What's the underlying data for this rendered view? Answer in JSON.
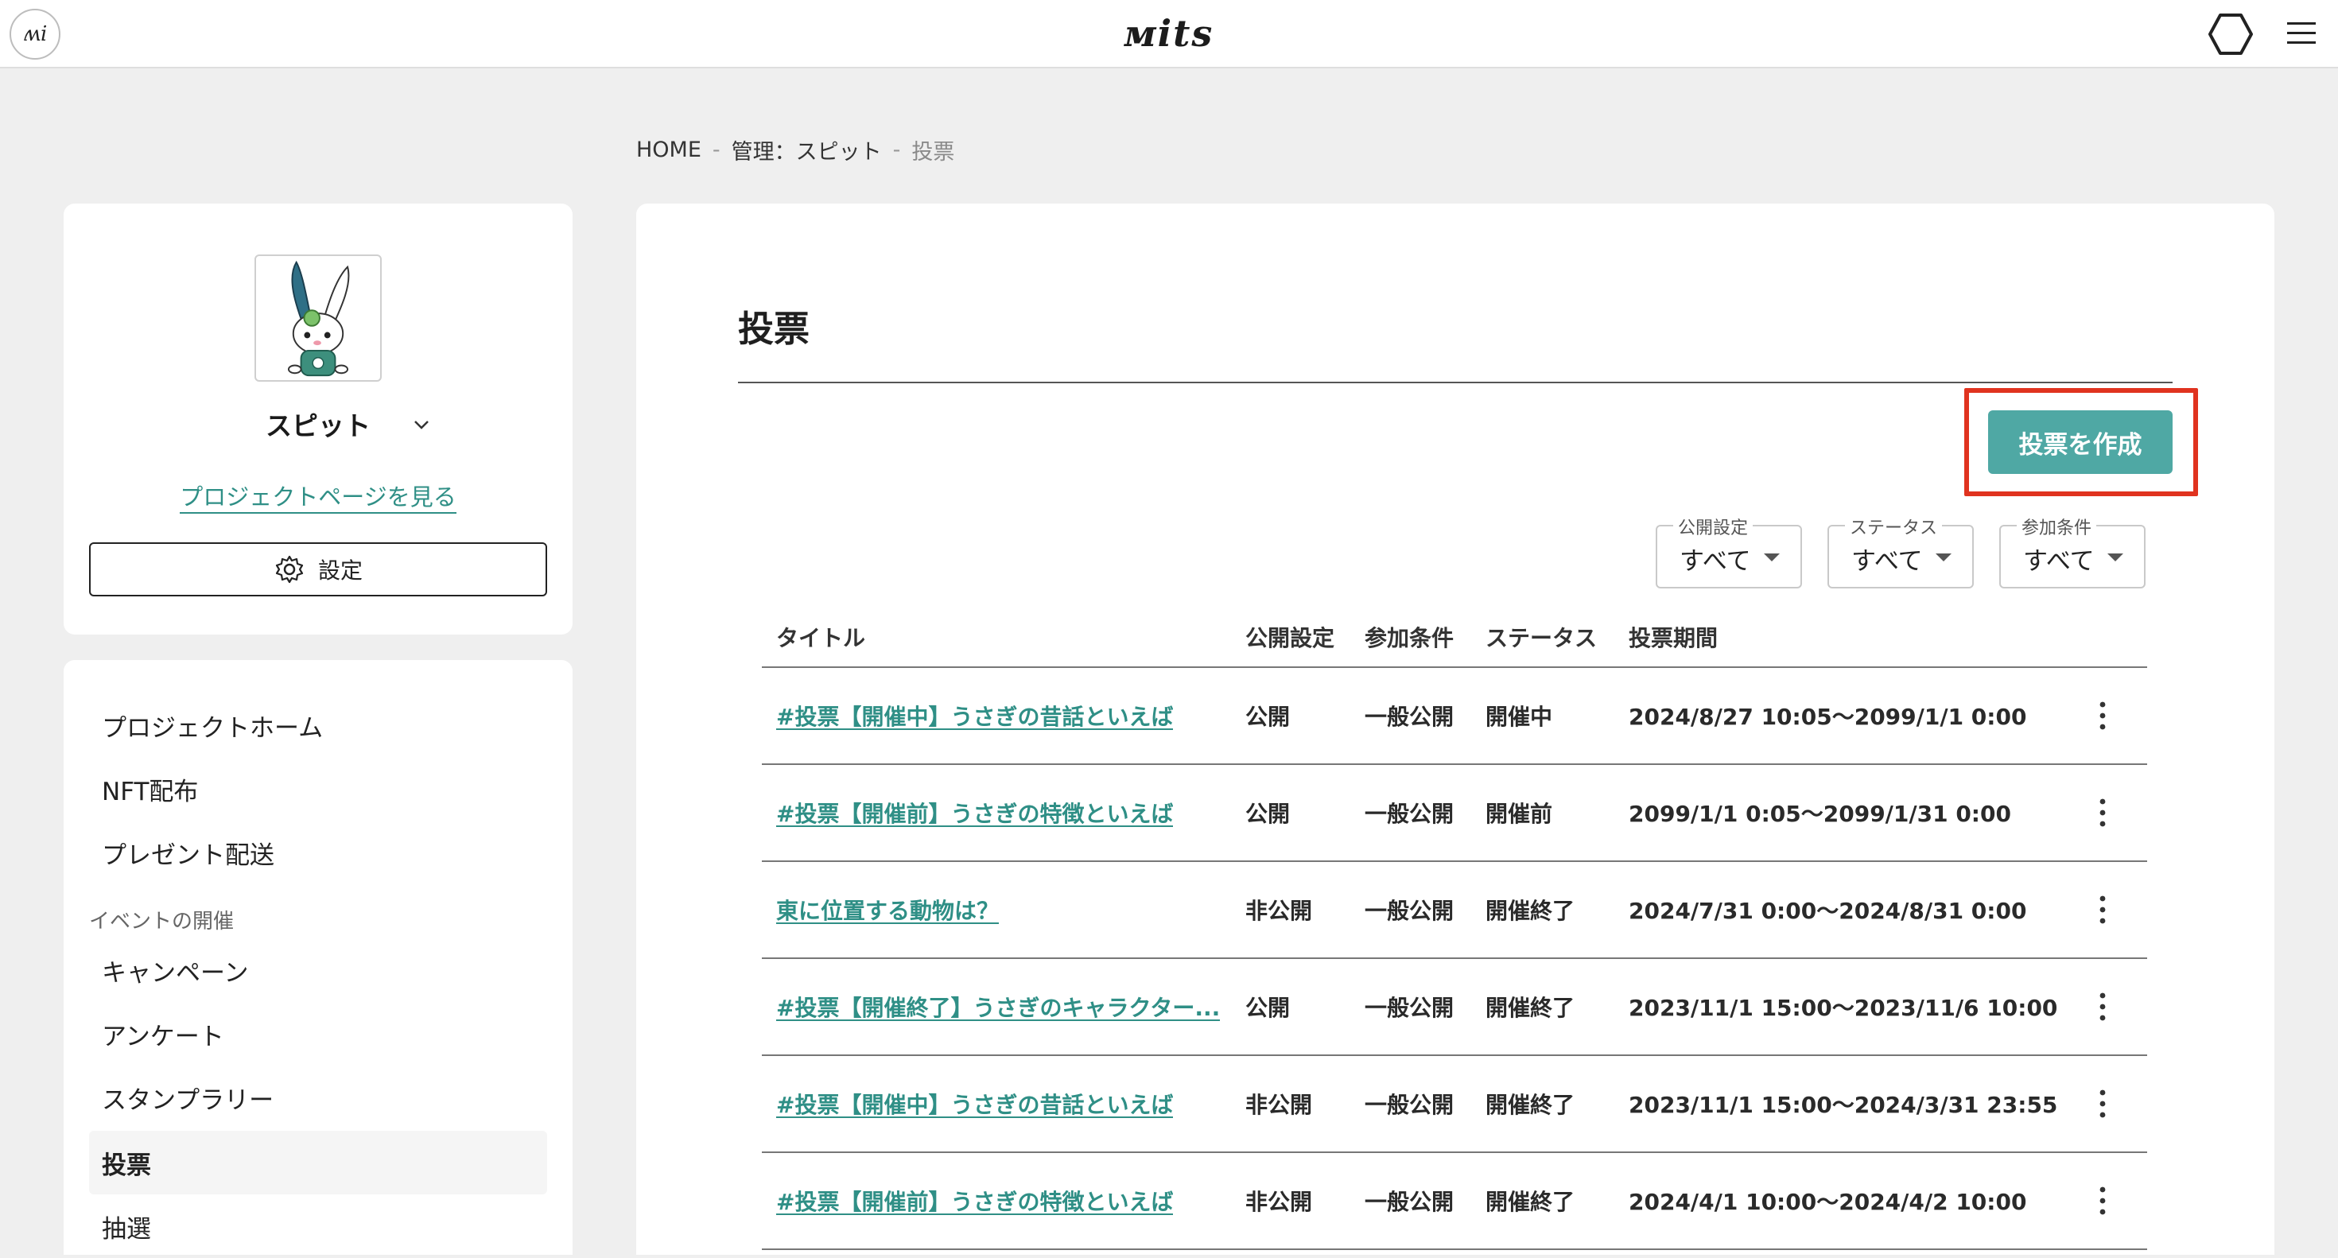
{
  "header": {
    "app_badge": "ʍi",
    "brand": "ᴍits",
    "icons": [
      "hexagon-icon",
      "hamburger-menu-icon"
    ]
  },
  "breadcrumb": {
    "items": [
      "HOME",
      "管理：スピット",
      "投票"
    ],
    "separator": "-"
  },
  "profile": {
    "name": "スピット",
    "project_link": "プロジェクトページを見る",
    "settings_label": "設定"
  },
  "nav": {
    "items": [
      "プロジェクトホーム",
      "NFT配布",
      "プレゼント配送"
    ],
    "section_label": "イベントの開催",
    "event_items": [
      "キャンペーン",
      "アンケート",
      "スタンプラリー",
      "投票",
      "抽選"
    ],
    "active": "投票"
  },
  "main": {
    "title": "投票",
    "create_button": "投票を作成",
    "filters": [
      {
        "label": "公開設定",
        "value": "すべて"
      },
      {
        "label": "ステータス",
        "value": "すべて"
      },
      {
        "label": "参加条件",
        "value": "すべて"
      }
    ],
    "columns": [
      "タイトル",
      "公開設定",
      "参加条件",
      "ステータス",
      "投票期間"
    ],
    "rows": [
      {
        "title": "#投票【開催中】うさぎの昔話といえば",
        "visibility": "公開",
        "condition": "一般公開",
        "status": "開催中",
        "period": "2024/8/27 10:05〜2099/1/1 0:00"
      },
      {
        "title": "#投票【開催前】うさぎの特徴といえば",
        "visibility": "公開",
        "condition": "一般公開",
        "status": "開催前",
        "period": "2099/1/1 0:05〜2099/1/31 0:00"
      },
      {
        "title": "東に位置する動物は？",
        "visibility": "非公開",
        "condition": "一般公開",
        "status": "開催終了",
        "period": "2024/7/31 0:00〜2024/8/31 0:00"
      },
      {
        "title": "#投票【開催終了】うさぎのキャラクター...",
        "visibility": "公開",
        "condition": "一般公開",
        "status": "開催終了",
        "period": "2023/11/1 15:00〜2023/11/6 10:00"
      },
      {
        "title": "#投票【開催中】うさぎの昔話といえば",
        "visibility": "非公開",
        "condition": "一般公開",
        "status": "開催終了",
        "period": "2023/11/1 15:00〜2024/3/31 23:55"
      },
      {
        "title": "#投票【開催前】うさぎの特徴といえば",
        "visibility": "非公開",
        "condition": "一般公開",
        "status": "開催終了",
        "period": "2024/4/1 10:00〜2024/4/2 10:00"
      }
    ]
  },
  "colors": {
    "accent": "#4fa8a4",
    "link": "#2f8f86",
    "highlight": "#e0331f",
    "background": "#efefef"
  }
}
